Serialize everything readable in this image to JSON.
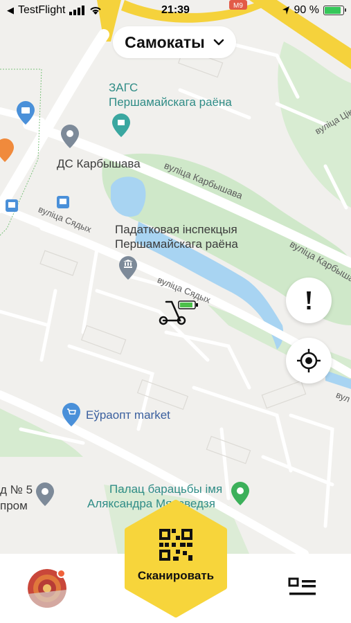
{
  "status_bar": {
    "back_app": "TestFlight",
    "time": "21:39",
    "battery_percent": "90 %",
    "battery_level": 0.9
  },
  "header": {
    "title": "Самокаты"
  },
  "map": {
    "metro_badge": "M9",
    "labels": {
      "zags_line1": "ЗАГС",
      "zags_line2": "Першамайскага раёна",
      "ds_karbyshava": "ДС Карбышава",
      "street_karbyshava_1": "вуліца Карбышава",
      "street_karbyshava_2": "вуліца Карбышава",
      "street_siadykh_1": "вуліца Сядых",
      "street_siadykh_2": "вуліца Сядых",
      "street_tsik": "вуліца Цікоц",
      "street_edge": "вул",
      "tax_line1": "Падатковая інспекцыя",
      "tax_line2": "Першамайскага раёна",
      "euroopt": "Еўраопт market",
      "palace_line1": "Палац барацьбы імя",
      "palace_line2": "Аляксандра Мядзведзя",
      "left_line1": "д № 5",
      "left_line2": "пром"
    },
    "accent_color": "#f5d23c",
    "park_color": "#cfe8c9",
    "water_color": "#a8d4f2",
    "scooter_battery_color": "#4cc04a"
  },
  "buttons": {
    "report": "report-button",
    "locate": "locate-button",
    "scan_label": "Сканировать",
    "scan_color": "#f7d53b"
  },
  "notification_color": "#f0623a"
}
